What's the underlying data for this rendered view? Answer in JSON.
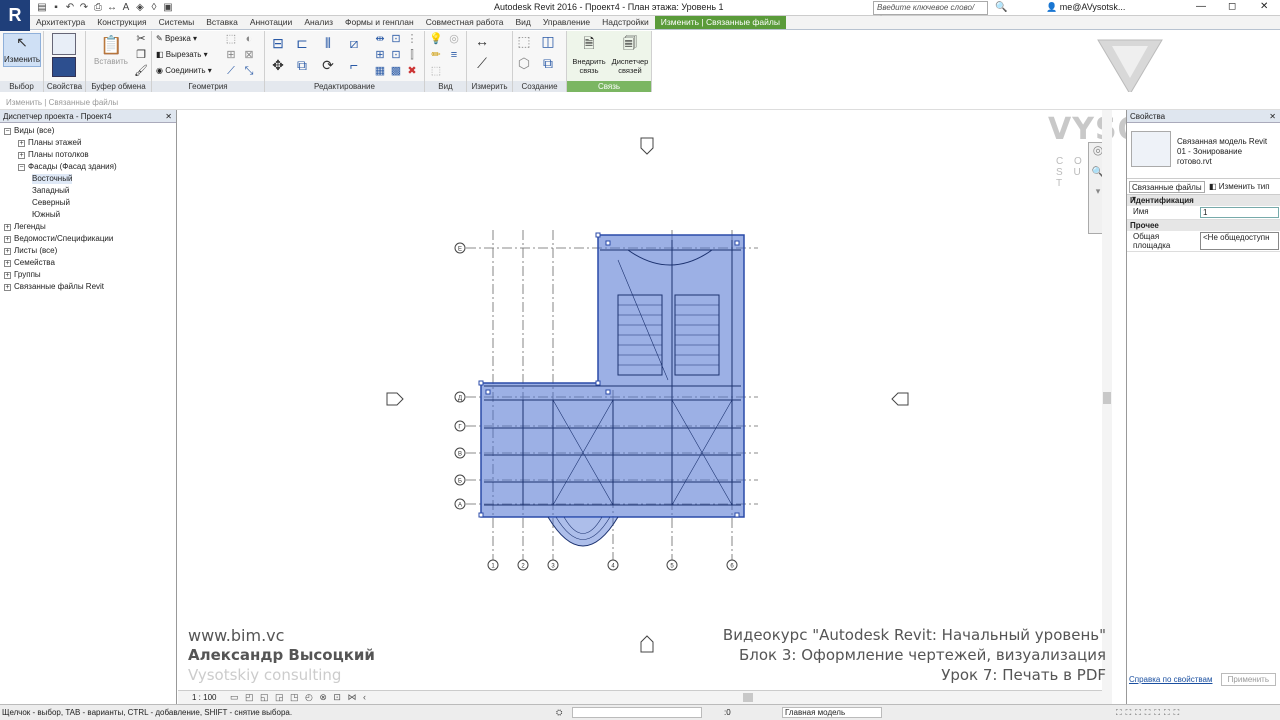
{
  "window": {
    "title": "Autodesk Revit 2016 -    Проект4 - План этажа: Уровень 1",
    "search_placeholder": "Введите ключевое слово/фразу",
    "user": "me@AVysotsk...",
    "logo": "R"
  },
  "tabs": [
    "Архитектура",
    "Конструкция",
    "Системы",
    "Вставка",
    "Аннотации",
    "Анализ",
    "Формы и генплан",
    "Совместная работа",
    "Вид",
    "Управление",
    "Надстройки",
    "Изменить | Связанные файлы"
  ],
  "ribbon": {
    "modify_label": "Изменить",
    "paste_label": "Вставить",
    "cut_label": "Врезка",
    "join_label": "Соединить",
    "cutgeom_label": "Вырезать",
    "embed_label": "Внедрить связь",
    "manager_label": "Диспетчер связей",
    "panels": {
      "select": "Выбор",
      "props": "Свойства",
      "clipboard": "Буфер обмена",
      "geometry": "Геометрия",
      "edit": "Редактирование",
      "view": "Вид",
      "measure": "Измерить",
      "create": "Создание",
      "link": "Связь"
    }
  },
  "context_bar": "Изменить | Связанные файлы",
  "browser": {
    "title": "Диспетчер проекта - Проект4",
    "items": [
      "Виды (все)",
      "Планы этажей",
      "Планы потолков",
      "Фасады (Фасад здания)",
      "Восточный",
      "Западный",
      "Северный",
      "Южный",
      "Легенды",
      "Ведомости/Спецификации",
      "Листы (все)",
      "Семейства",
      "Группы",
      "Связанные файлы Revit"
    ]
  },
  "properties": {
    "title": "Свойства",
    "type_line1": "Связанная модель Revit",
    "type_line2": "01 - Зонирование",
    "type_line3": "готово.rvt",
    "selector": "Связанные файлы",
    "edit_type": "Изменить тип",
    "group1": "Идентификация",
    "name_label": "Имя",
    "name_value": "1",
    "group2": "Прочее",
    "shared_label": "Общая площадка",
    "shared_value": "<Не общедоступн",
    "help_link": "Справка по свойствам",
    "apply": "Применить"
  },
  "watermark": {
    "brand": "VYSOTSKIY",
    "brand_sub": "C O N S U L T"
  },
  "overlay": {
    "site": "www.bim.vc",
    "author": "Александр Высоцкий",
    "company": "Vysotskiy consulting",
    "course": "Видеокурс \"Autodesk Revit: Начальный уровень\"",
    "block": "Блок 3: Оформление чертежей, визуализация",
    "lesson": "Урок 7: Печать в PDF"
  },
  "view_controls": {
    "scale": "1 : 100"
  },
  "grid_labels": {
    "vertical": [
      "1",
      "2",
      "3",
      "4",
      "5",
      "6"
    ],
    "horizontal": [
      "Е",
      "Д",
      "Г",
      "В",
      "Б",
      "А"
    ]
  },
  "status": {
    "text": "Щелчок - выбор, TAB - варианты, CTRL - добавление, SHIFT - снятие выбора.",
    "count": ":0",
    "model": "Главная модель"
  },
  "colors": {
    "accent": "#5a9b3a",
    "selection": "#4a6fd0"
  }
}
